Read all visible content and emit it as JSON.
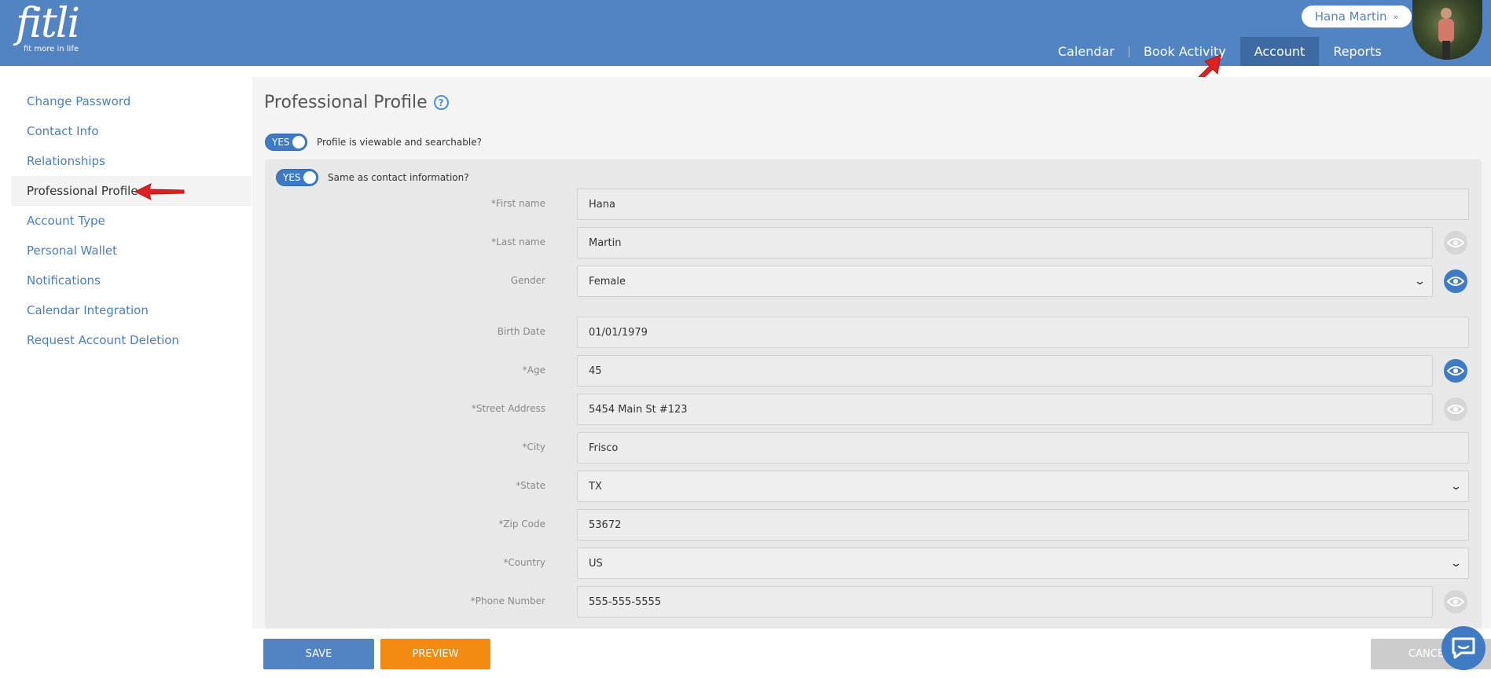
{
  "brand": {
    "logo_text": "fitli",
    "tagline": "fit more in life"
  },
  "user": {
    "name": "Hana Martin",
    "chevron": "»"
  },
  "nav": {
    "items": [
      {
        "label": "Calendar"
      },
      {
        "label": "Book Activity"
      },
      {
        "label": "Account",
        "active": true
      },
      {
        "label": "Reports"
      }
    ]
  },
  "sidebar": {
    "items": [
      {
        "label": "Change Password"
      },
      {
        "label": "Contact Info"
      },
      {
        "label": "Relationships"
      },
      {
        "label": "Professional Profile",
        "active": true
      },
      {
        "label": "Account Type"
      },
      {
        "label": "Personal Wallet"
      },
      {
        "label": "Notifications"
      },
      {
        "label": "Calendar Integration"
      },
      {
        "label": "Request Account Deletion"
      }
    ]
  },
  "main": {
    "title": "Professional Profile",
    "help_icon": "?",
    "viewable_toggle": {
      "value": "YES",
      "label": "Profile is viewable and searchable?"
    },
    "same_contact_toggle": {
      "value": "YES",
      "label": "Same as contact information?"
    }
  },
  "form": {
    "first_name": {
      "label": "*First name",
      "value": "Hana"
    },
    "last_name": {
      "label": "*Last name",
      "value": "Martin",
      "visibility": "hidden"
    },
    "gender": {
      "label": "Gender",
      "value": "Female",
      "visibility": "visible"
    },
    "birth_date": {
      "label": "Birth Date",
      "value": "01/01/1979"
    },
    "age": {
      "label": "*Age",
      "value": "45",
      "visibility": "visible"
    },
    "street": {
      "label": "*Street Address",
      "value": "5454 Main St #123",
      "visibility": "hidden"
    },
    "city": {
      "label": "*City",
      "value": "Frisco"
    },
    "state": {
      "label": "*State",
      "value": "TX"
    },
    "zip": {
      "label": "*Zip Code",
      "value": "53672"
    },
    "country": {
      "label": "*Country",
      "value": "US"
    },
    "phone": {
      "label": "*Phone Number",
      "value": "555-555-5555",
      "visibility": "hidden"
    }
  },
  "footer": {
    "save_label": "SAVE",
    "preview_label": "PREVIEW",
    "cancel_label": "CANCEL"
  },
  "colors": {
    "header": "#5283c2",
    "accent": "#3e7bc4",
    "preview": "#f38b13",
    "annotation_arrow": "#e02020"
  }
}
